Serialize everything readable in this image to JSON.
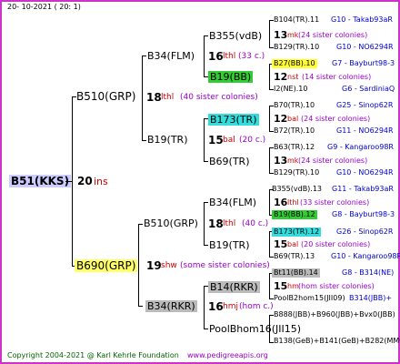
{
  "header": {
    "date": "20-  10-2021  ( 20:  1)"
  },
  "root": {
    "name": "B51(KKS)",
    "num": "20",
    "label": "ins",
    "color": "#ccccff"
  },
  "gen1": [
    {
      "name": "B510(GRP)",
      "num": "18",
      "label": "lthl",
      "note": "(40 sister colonies)"
    },
    {
      "name": "B690(GRP)",
      "num": "19",
      "label": "shw",
      "note": "(some sister colonies)",
      "color": "#ffff66"
    }
  ],
  "gen2": [
    {
      "name": "B34(FLM)",
      "num": "16",
      "label": "lthl",
      "note": "(33 c.)"
    },
    {
      "name": "B19(TR)",
      "num": "15",
      "label": "bal",
      "note": "(20 c.)"
    },
    {
      "name": "B510(GRP)",
      "num": "18",
      "label": "lthl",
      "note": "(40 c.)"
    },
    {
      "name": "B34(RKR)",
      "num": "16",
      "label": "hmj",
      "note": "(hom c.)",
      "color": "#bbbbbb"
    }
  ],
  "gen3": [
    {
      "name": "B355(vdB)",
      "num": "13",
      "label": "mk",
      "note": "(24 sister colonies)"
    },
    {
      "name": "B19(BB)",
      "color": "#33cc33"
    },
    {
      "name": "B173(TR)",
      "num": "12",
      "label": "bal",
      "note": "(24 sister colonies)",
      "color": "#33dddd"
    },
    {
      "name": "B69(TR)",
      "num": "13",
      "label": "mk",
      "note": "(24 sister colonies)"
    },
    {
      "name": "B34(FLM)",
      "num": "16",
      "label": "lthl",
      "note": "(33 sister colonies)"
    },
    {
      "name": "B19(TR)",
      "num": "15",
      "label": "bal",
      "note": "(20 sister colonies)"
    },
    {
      "name": "B14(RKR)",
      "num": "15",
      "label": "hm",
      "note": "(hom sister colonies)",
      "color": "#bbbbbb"
    },
    {
      "name": "PoolBhom16(JII15)"
    }
  ],
  "gen4": [
    {
      "name": "B104(TR).11",
      "info": "G10 - Takab93aR"
    },
    {
      "name": "B129(TR).10",
      "info": "G10 - NO6294R"
    },
    {
      "name": "B27(BB).10",
      "info": "G7 - Bayburt98-3",
      "color": "#ffff33"
    },
    {
      "name": "I2(NE).10",
      "info": "G6 - SardiniaQ",
      "extra_num": "12",
      "extra_label": "nst",
      "extra_note": "(14 sister colonies)"
    },
    {
      "name": "B70(TR).10",
      "info": "G25 - Sinop62R"
    },
    {
      "name": "B72(TR).10",
      "info": "G11 - NO6294R"
    },
    {
      "name": "B63(TR).12",
      "info": "G9 - Kangaroo98R"
    },
    {
      "name": "B129(TR).10",
      "info": "G10 - NO6294R"
    },
    {
      "name": "B355(vdB).13",
      "info": "G11 - Takab93aR"
    },
    {
      "name": "B19(BB).12",
      "info": "G8 - Bayburt98-3",
      "color": "#33cc33"
    },
    {
      "name": "B173(TR).12",
      "info": "G26 - Sinop62R",
      "color": "#33dddd"
    },
    {
      "name": "B69(TR).13",
      "info": "G10 - Kangaroo98R"
    },
    {
      "name": "Bt11(BB).14",
      "info": "G8 - B314(NE)",
      "color": "#bbbbbb"
    },
    {
      "name": "PoolB2hom15(JII09)",
      "info": "B314(JBB)+"
    },
    {
      "name": "B888(JBB)+B960(JBB)+Bvx0(JBB)",
      "info": ""
    },
    {
      "name": "B138(GeB)+B141(GeB)+B282(MMG)",
      "info": ""
    }
  ],
  "footer": {
    "copyright": "Copyright 2004-2021 @ Karl Kehrle Foundation",
    "site": "www.pedigreeapis.org"
  }
}
